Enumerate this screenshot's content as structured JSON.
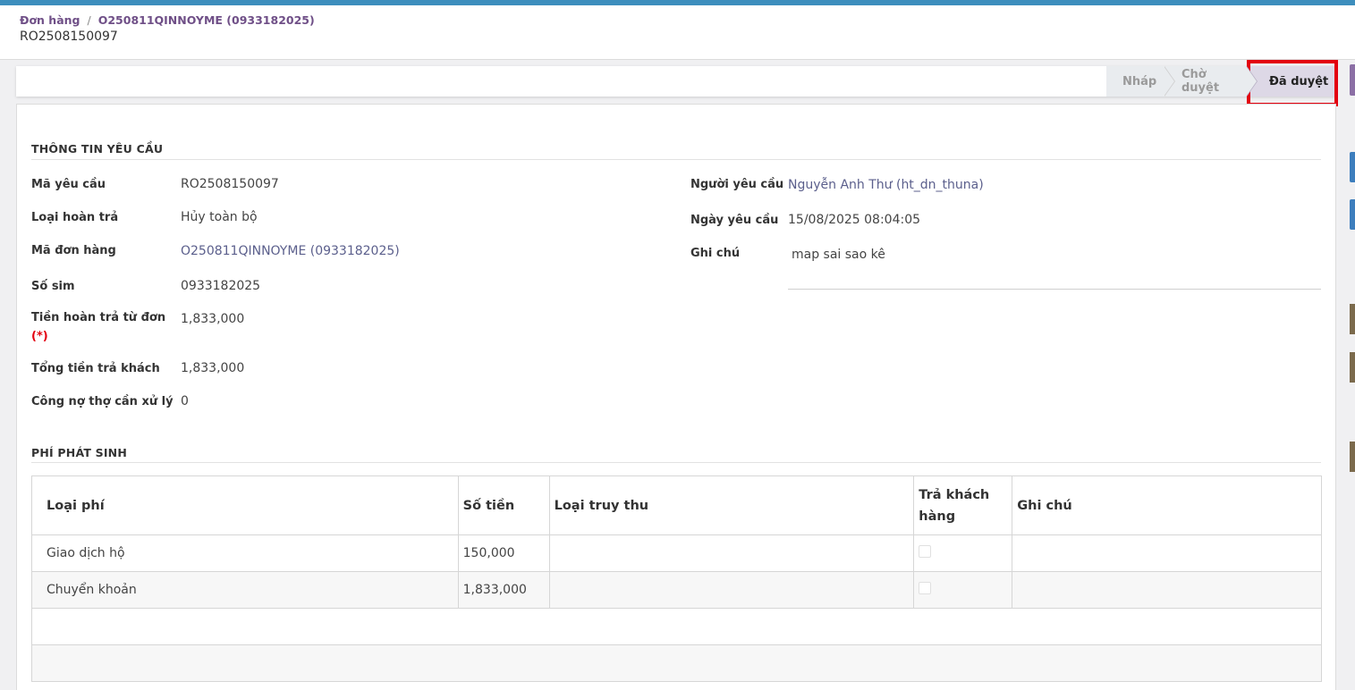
{
  "breadcrumb": {
    "root": "Đơn hàng",
    "separator": "/",
    "parent": "O250811QINNOYME (0933182025)"
  },
  "record_title": "RO2508150097",
  "status_stages": [
    {
      "label": "Nháp",
      "active": false
    },
    {
      "label": "Chờ duyệt",
      "active": false
    },
    {
      "label": "Đã duyệt",
      "active": true
    }
  ],
  "request_info": {
    "section_title": "THÔNG TIN YÊU CẦU",
    "fields_left": [
      {
        "label": "Mã yêu cầu",
        "value": "RO2508150097"
      },
      {
        "label": "Loại hoàn trả",
        "value": "Hủy toàn bộ"
      },
      {
        "label": "Mã đơn hàng",
        "value": "O250811QINNOYME (0933182025)"
      },
      {
        "label": "Số sim",
        "value": "0933182025"
      },
      {
        "label": "Tiền hoàn trả từ đơn",
        "required_mark": "(*)",
        "value": "1,833,000"
      },
      {
        "label": "Tổng tiền trả khách",
        "value": "1,833,000"
      },
      {
        "label": "Công nợ thợ cần xử lý",
        "value": "0"
      }
    ],
    "fields_right": [
      {
        "label": "Người yêu cầu",
        "value": "Nguyễn Anh Thư (ht_dn_thuna)"
      },
      {
        "label": "Ngày yêu cầu",
        "value": "15/08/2025 08:04:05"
      },
      {
        "label": "Ghi chú",
        "value": "map sai sao kê"
      }
    ]
  },
  "fees": {
    "section_title": "PHÍ PHÁT SINH",
    "columns": [
      "Loại phí",
      "Số tiền",
      "Loại truy thu",
      "Trả khách hàng",
      "Ghi chú"
    ],
    "rows": [
      {
        "fee_type": "Giao dịch hộ",
        "amount": "150,000",
        "collection_type": "",
        "refund_customer": false,
        "note": ""
      },
      {
        "fee_type": "Chuyển khoản",
        "amount": "1,833,000",
        "collection_type": "",
        "refund_customer": false,
        "note": ""
      }
    ]
  },
  "colors": {
    "top_bar": "#3d8ebd",
    "link": "#6f4f87",
    "active_stage": "#ddd8e6",
    "highlight": "#e3000f",
    "required": "#e3000f"
  }
}
